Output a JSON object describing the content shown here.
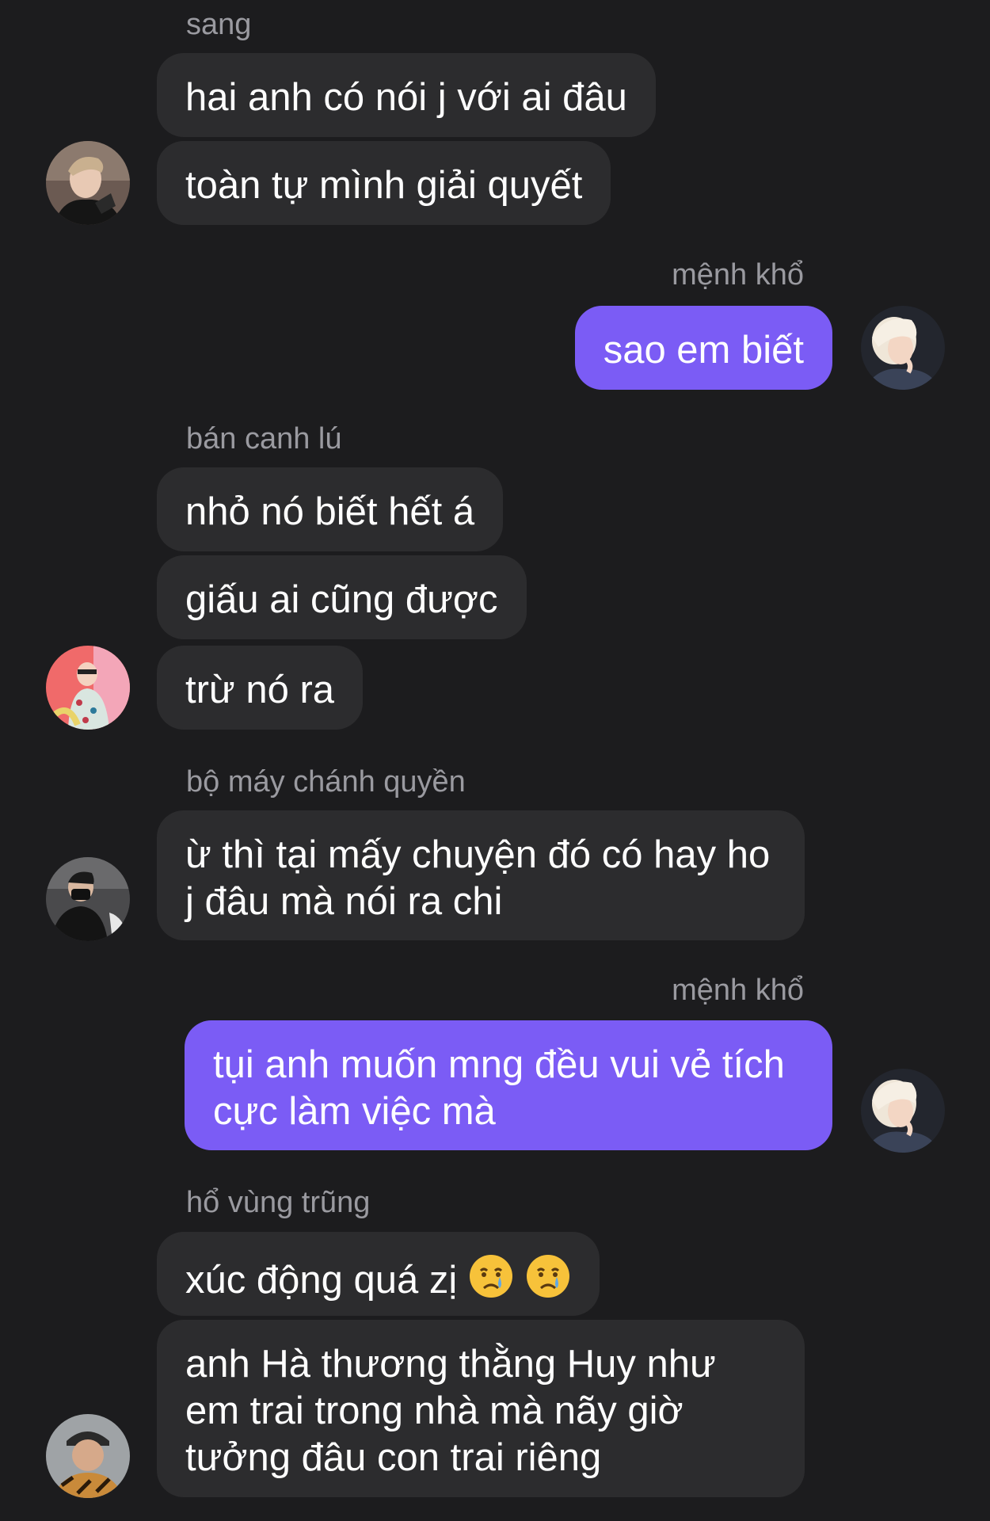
{
  "messages": [
    {
      "sender": "sang",
      "bubbles": [
        "hai anh có nói j với ai đâu",
        "toàn tự mình giải quyết"
      ],
      "side": "left",
      "avatar": "avatar-sang"
    },
    {
      "sender": "mệnh khổ",
      "bubbles": [
        "sao em biết"
      ],
      "side": "right",
      "avatar": "avatar-menh-kho"
    },
    {
      "sender": "bán canh lú",
      "bubbles": [
        "nhỏ nó biết hết á",
        "giấu ai cũng được",
        "trừ nó ra"
      ],
      "side": "left",
      "avatar": "avatar-ban-canh-lu"
    },
    {
      "sender": "bộ máy chánh quyền",
      "bubbles": [
        "ừ thì tại mấy chuyện đó có hay ho j đâu mà nói ra chi"
      ],
      "side": "left",
      "avatar": "avatar-bo-may"
    },
    {
      "sender": "mệnh khổ",
      "bubbles": [
        "tụi anh muốn mng đều vui vẻ tích cực làm việc mà"
      ],
      "side": "right",
      "avatar": "avatar-menh-kho"
    },
    {
      "sender": "hổ vùng trũng",
      "bubbles": [
        "xúc động quá zị",
        "anh Hà thương thằng Huy như em trai trong nhà mà nãy giờ tưởng đâu con trai riêng"
      ],
      "side": "left",
      "avatar": "avatar-ho-vung-trung",
      "emoji": "crying-face-icon"
    }
  ],
  "colors": {
    "background": "#1c1c1e",
    "incoming_bubble": "#2c2c2e",
    "outgoing_bubble": "#7b5cf5",
    "sender_name": "#9a9aa0",
    "text": "#ffffff"
  }
}
